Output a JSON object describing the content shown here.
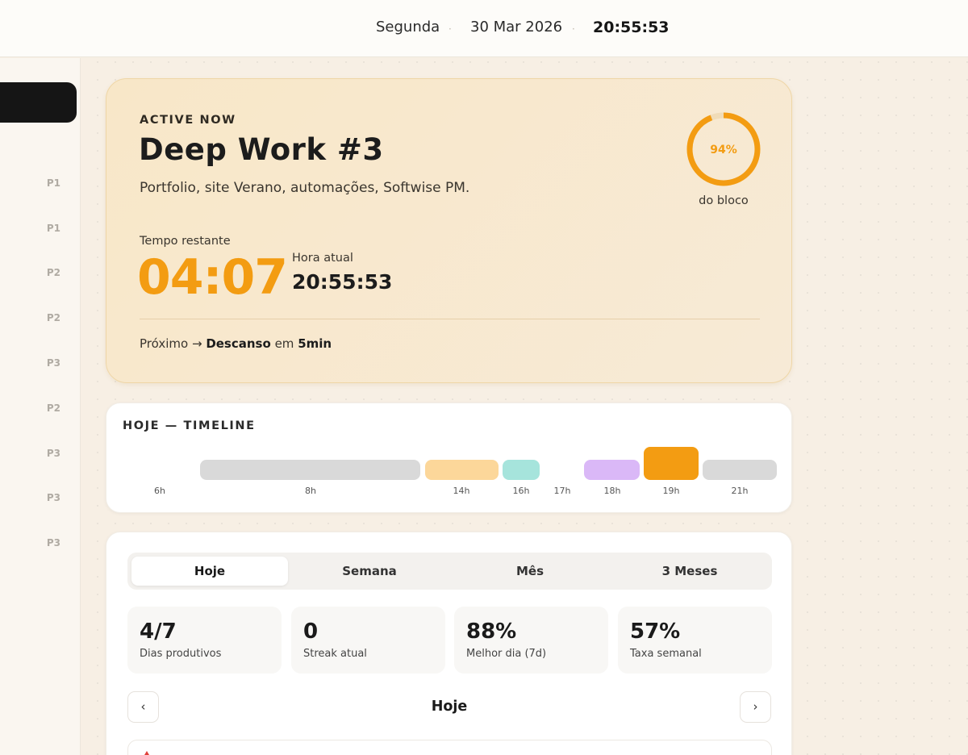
{
  "topbar": {
    "day": "Segunda",
    "separator": "·",
    "date": "30 Mar 2026",
    "time": "20:55:53"
  },
  "sidebar": {
    "items": [
      {
        "label": "P1"
      },
      {
        "label": "P1"
      },
      {
        "label": "P2"
      },
      {
        "label": "P2"
      },
      {
        "label": "P3"
      },
      {
        "label": "P2"
      },
      {
        "label": "P3"
      },
      {
        "label": "P3"
      },
      {
        "label": "P3"
      }
    ]
  },
  "active": {
    "kicker": "ACTIVE NOW",
    "title": "Deep Work #3",
    "description": "Portfolio, site Verano, automações, Softwise PM.",
    "remaining_label": "Tempo restante",
    "remaining": "04:07",
    "current_label": "Hora atual",
    "current_time": "20:55:53",
    "next_prefix": "Próximo",
    "next_arrow": "→",
    "next_name": "Descanso",
    "next_in": "em",
    "next_duration": "5min",
    "progress_percent": 94,
    "progress_text": "94%",
    "progress_label": "do bloco",
    "accent_color": "#f39c12"
  },
  "timeline": {
    "title": "HOJE — TIMELINE",
    "hours": [
      "6h",
      "8h",
      "14h",
      "16h",
      "17h",
      "18h",
      "19h",
      "21h"
    ],
    "segment_colors": [
      "#d9d9d9",
      "#fcd79a",
      "#a6e4dc",
      "#dab8f7",
      "#f39c12",
      "#d9d9d9"
    ]
  },
  "stats": {
    "tabs": [
      {
        "label": "Hoje",
        "active": true
      },
      {
        "label": "Semana",
        "active": false
      },
      {
        "label": "Mês",
        "active": false
      },
      {
        "label": "3 Meses",
        "active": false
      }
    ],
    "cards": [
      {
        "value": "4/7",
        "label": "Dias produtivos"
      },
      {
        "value": "0",
        "label": "Streak atual"
      },
      {
        "value": "88%",
        "label": "Melhor dia (7d)"
      },
      {
        "value": "57%",
        "label": "Taxa semanal"
      }
    ],
    "nav": {
      "prev": "‹",
      "title": "Hoje",
      "next": "›"
    },
    "warn_icon": "warning-icon"
  }
}
